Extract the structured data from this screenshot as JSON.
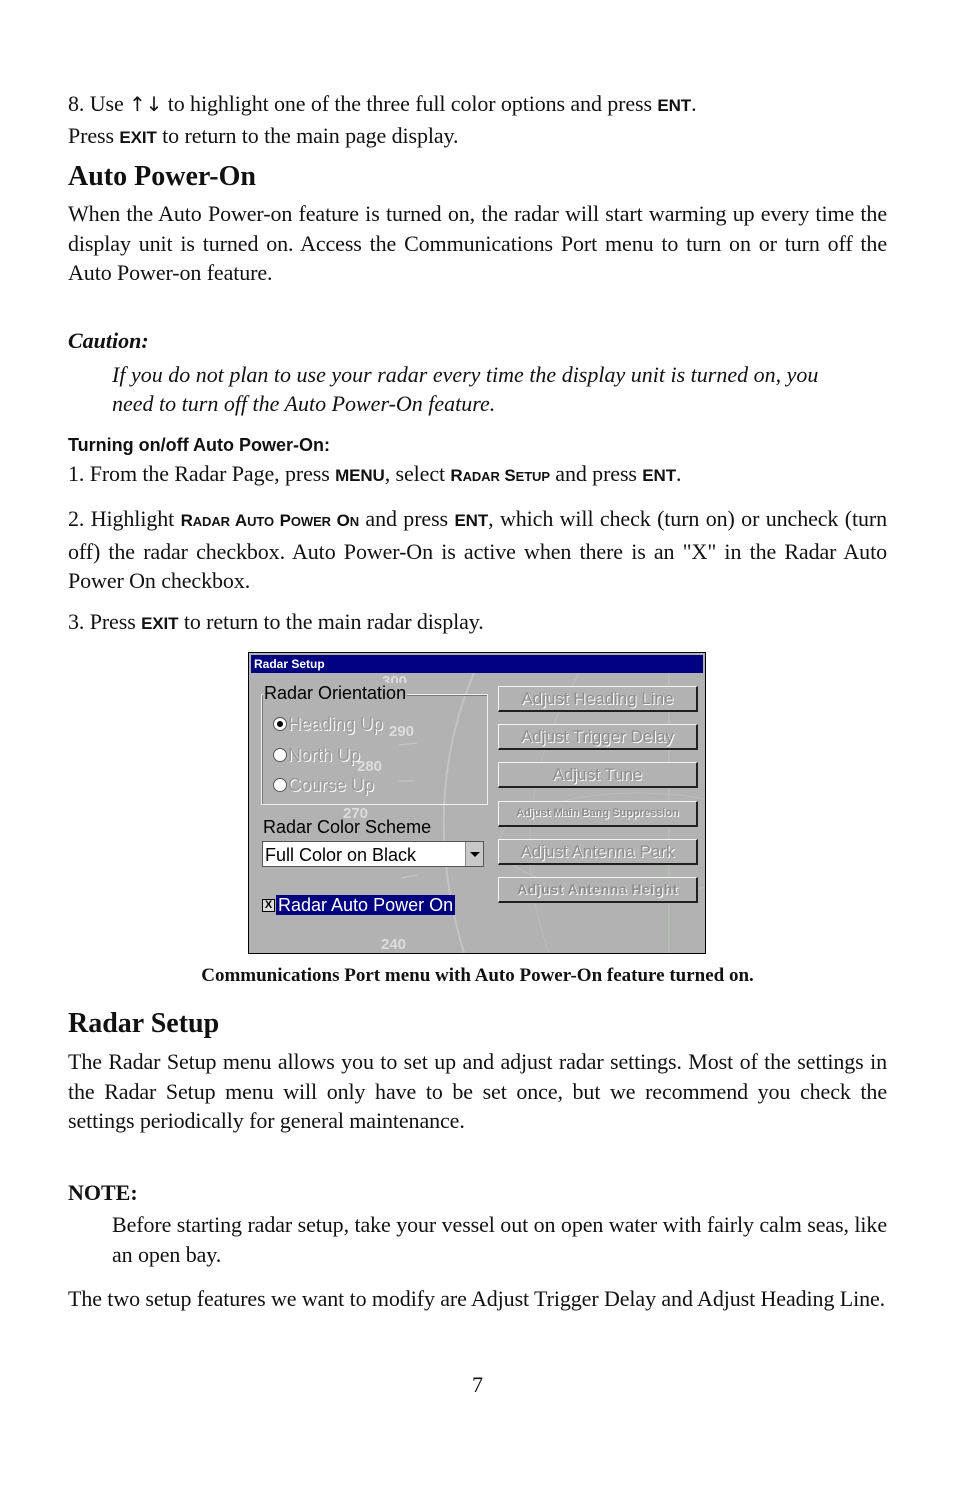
{
  "step8": {
    "prefix": "8. Use ",
    "arrows": "↑↓",
    "middle": " to highlight one of the three full color options and press ",
    "key_ent": "ENT",
    "period": ".",
    "line2_prefix": "Press ",
    "key_exit": "EXIT",
    "line2_suffix": " to return to the main page display."
  },
  "auto_power_on": {
    "heading": "Auto Power-On",
    "body": "When the Auto Power-on feature is turned on, the radar will start warming up every time the display unit is turned on. Access the Communications Port menu to turn on or turn off the Auto Power-on feature.",
    "caution_label": "Caution:",
    "caution_text": "If you do not plan to use your radar every time the display unit is turned on, you need to turn off the Auto Power-On feature.",
    "subheading": "Turning on/off Auto Power-On:",
    "step1": {
      "prefix": "1. From the Radar Page, press ",
      "key_menu": "MENU",
      "mid": ", select ",
      "sc_r": "R",
      "sc_adar": "ADAR",
      "sc_s": "S",
      "sc_etup": "ETUP",
      "mid2": " and press ",
      "key_ent": "ENT",
      "end": "."
    },
    "step2": {
      "prefix": "2. Highlight ",
      "sc_r": "R",
      "sc_adar": "ADAR",
      "sc_a": "A",
      "sc_uto": "UTO",
      "sc_p": "P",
      "sc_ower": "OWER",
      "sc_o": "O",
      "sc_n": "N",
      "mid": " and press ",
      "key_ent": "ENT",
      "rest": ", which will check (turn on) or uncheck (turn off) the radar checkbox. Auto Power-On is active when there is an \"X\" in the Radar Auto Power On checkbox."
    },
    "step3": {
      "prefix": "3. Press ",
      "key_exit": "EXIT",
      "suffix": " to return to the main radar display."
    }
  },
  "dialog": {
    "title": "Radar Setup",
    "orientation_group": "Radar Orientation",
    "orientation_options": [
      {
        "label": "Heading Up",
        "selected": true
      },
      {
        "label": "North Up",
        "selected": false
      },
      {
        "label": "Course Up",
        "selected": false
      }
    ],
    "color_scheme_label": "Radar Color Scheme",
    "color_scheme_value": "Full Color on Black",
    "auto_power_checkbox": {
      "label": "Radar Auto Power On",
      "checked": true,
      "mark": "X"
    },
    "buttons": [
      "Adjust Heading Line",
      "Adjust Trigger Delay",
      "Adjust Tune",
      "Adjust Main Bang Suppression",
      "Adjust Antenna Park",
      "Adjust Antenna Height"
    ],
    "radar_bearings": [
      "300",
      "290",
      "280",
      "270",
      "240"
    ],
    "colors": {
      "title_bar": "#000080",
      "background": "#b2b2b2",
      "highlight": "#000080"
    }
  },
  "figure_caption": "Communications Port menu with Auto Power-On feature turned on.",
  "radar_setup": {
    "heading": "Radar Setup",
    "body": "The Radar Setup menu allows you to set up and adjust radar settings. Most of the settings in the Radar Setup menu will only have to be set once, but we recommend you check the settings periodically for general maintenance.",
    "note_label": "NOTE:",
    "note_text": "Before starting radar setup, take your vessel out on open water with fairly calm seas, like an open bay.",
    "closing": "The two setup features we want to modify are Adjust Trigger Delay and Adjust Heading Line."
  },
  "page_number": "7"
}
